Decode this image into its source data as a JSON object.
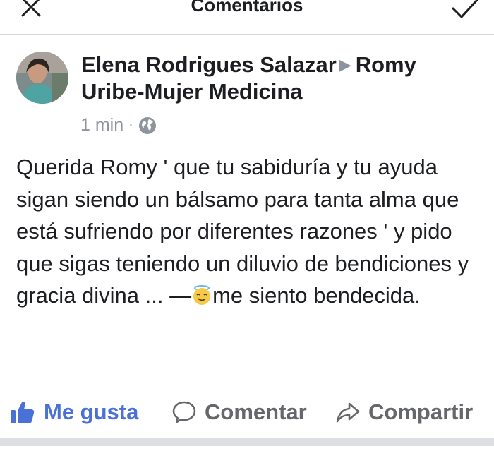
{
  "header": {
    "title": "Comentarios",
    "close_icon": "close-icon",
    "confirm_icon": "checkmark-icon"
  },
  "post": {
    "author": "Elena Rodrigues Salazar",
    "target": "Romy Uribe-Mujer Medicina",
    "time": "1 min",
    "separator": "·",
    "privacy_icon": "globe-icon",
    "text_main": "Querida Romy ' que tu sabiduría y tu ayuda sigan siendo un bálsamo para tanta alma que está sufriendo por diferentes razones ' y pido que sigas teniendo un diluvio de bendiciones y gracia divina ... —",
    "emoji_icon": "angel-emoji-icon",
    "text_feeling": "me siento bendecida."
  },
  "actions": {
    "like": "Me gusta",
    "comment": "Comentar",
    "share": "Compartir"
  },
  "colors": {
    "like_blue": "#4a72d6",
    "action_gray": "#65676b",
    "meta_gray": "#8d949e",
    "divider": "#d4d6da"
  }
}
